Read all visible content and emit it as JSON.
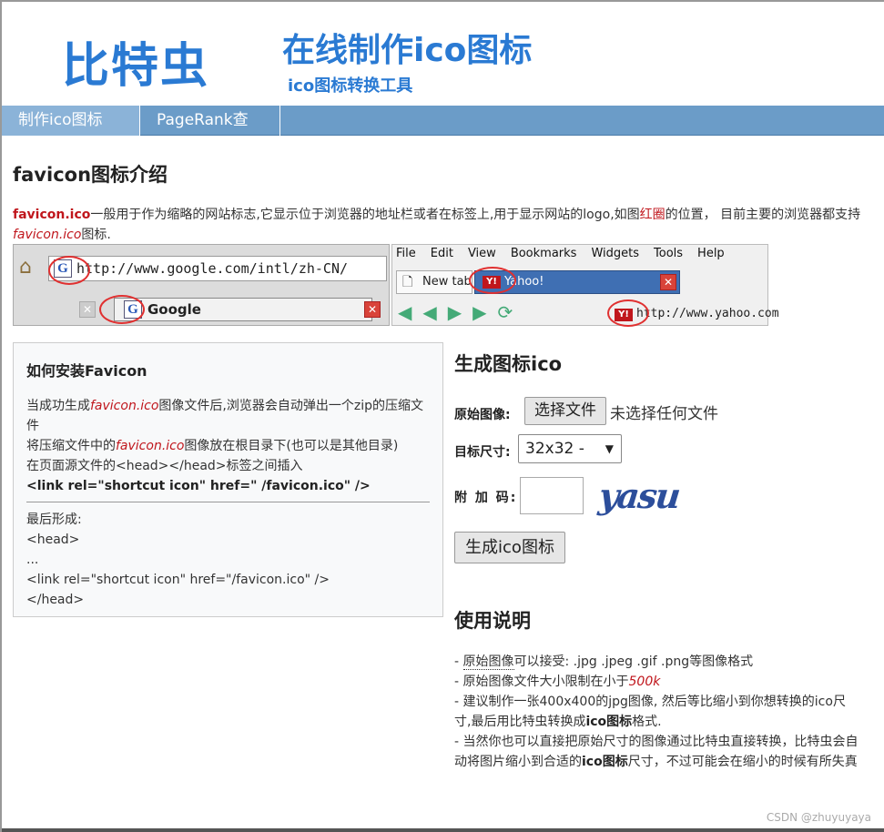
{
  "header": {
    "logo": "比特虫",
    "title": "在线制作ico图标",
    "subtitle": "ico图标转换工具"
  },
  "nav": {
    "items": [
      {
        "label": "制作ico图标"
      },
      {
        "label": "PageRank查询"
      }
    ]
  },
  "intro": {
    "title": "favicon图标介绍",
    "p1_strong": "favicon.ico",
    "p1_a": "一般用于作为缩略的网站标志,它显示位于浏览器的地址栏或者在标签上,用于显示网站的logo,如图",
    "p1_red": "红圈",
    "p1_b": "的位置， 目前主要的浏览器都支持",
    "p1_em": "favicon.ico",
    "p1_c": "图标."
  },
  "browser_demo": {
    "left_url": "http://www.google.com/intl/zh-CN/",
    "left_tab": "Google",
    "g_icon": "G",
    "menu": [
      "File",
      "Edit",
      "View",
      "Bookmarks",
      "Widgets",
      "Tools",
      "Help"
    ],
    "tab_new": "New tab",
    "tab_yahoo": "Yahoo!",
    "y_icon": "Y!",
    "right_url": "http://www.yahoo.com"
  },
  "install": {
    "title": "如何安装Favicon",
    "line1_a": "当成功生成",
    "line1_em": "favicon.ico",
    "line1_b": "图像文件后,浏览器会自动弹出一个zip的压缩文件",
    "line2_a": "将压缩文件中的",
    "line2_em": "favicon.ico",
    "line2_b": "图像放在根目录下(也可以是其他目录)",
    "line3": "在页面源文件的<head></head>标签之间插入",
    "line4": "<link rel=\"shortcut icon\" href=\" /favicon.ico\" />",
    "result_label": "最后形成:",
    "result_1": "<head>",
    "result_2": "...",
    "result_3": "<link rel=\"shortcut icon\" href=\"/favicon.ico\" />",
    "result_4": "</head>"
  },
  "generator": {
    "title": "生成图标ico",
    "source_label": "原始图像:",
    "file_button": "选择文件",
    "file_status": "未选择任何文件",
    "size_label": "目标尺寸:",
    "size_value": "32x32 -",
    "code_label": "附 加 码:",
    "captcha": "yasu",
    "submit": "生成ico图标"
  },
  "usage": {
    "title": "使用说明",
    "i1_prefix": "- ",
    "i1_ul": "原始图像",
    "i1_rest": "可以接受: .jpg .jpeg .gif .png等图像格式",
    "i2_a": "- 原始图像文件大小限制在小于",
    "i2_em": "500k",
    "i3_a": "- 建议制作一张400x400的jpg图像, 然后等比缩小到你想转换的ico尺寸,最后用比特虫转换成",
    "i3_b": "ico图标",
    "i3_c": "格式.",
    "i4_a": "- 当然你也可以直接把原始尺寸的图像通过比特虫直接转换，比特虫会自动将图片缩小到合适的",
    "i4_b": "ico图标",
    "i4_c": "尺寸，不过可能会在缩小的时候有所失真"
  },
  "watermark": "CSDN @zhuyuyaya",
  "colors": {
    "brand": "#2a7ad3",
    "nav": "#6b9cc8",
    "accent_red": "#c0161c"
  }
}
